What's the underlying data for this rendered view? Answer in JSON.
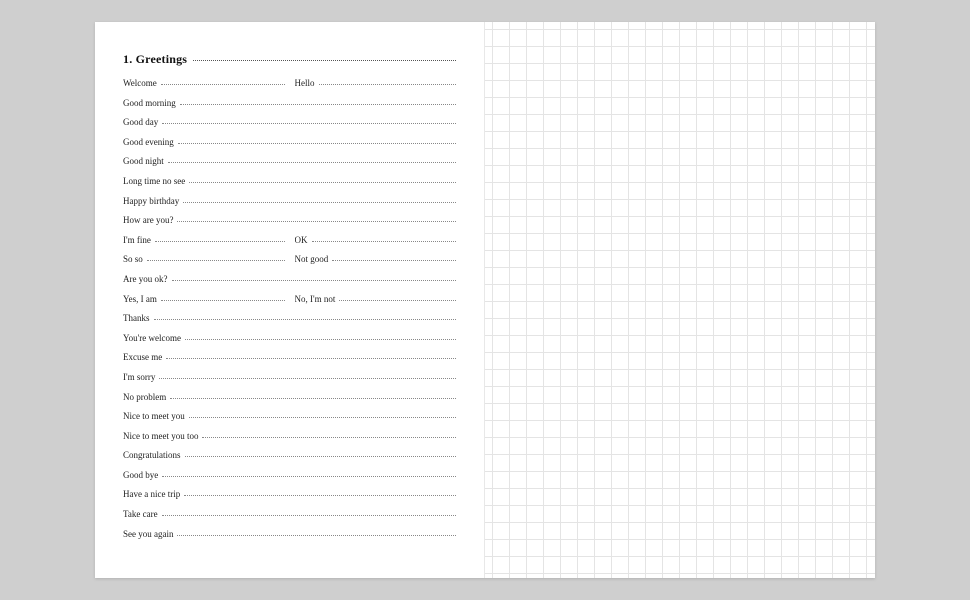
{
  "section": {
    "number": "1.",
    "title": "Greetings"
  },
  "rows": [
    {
      "cells": [
        {
          "label": "Welcome"
        },
        {
          "label": "Hello"
        }
      ]
    },
    {
      "cells": [
        {
          "label": "Good morning"
        }
      ]
    },
    {
      "cells": [
        {
          "label": "Good day"
        }
      ]
    },
    {
      "cells": [
        {
          "label": "Good evening"
        }
      ]
    },
    {
      "cells": [
        {
          "label": "Good night"
        }
      ]
    },
    {
      "cells": [
        {
          "label": "Long time no see"
        }
      ]
    },
    {
      "cells": [
        {
          "label": "Happy birthday"
        }
      ]
    },
    {
      "cells": [
        {
          "label": "How are you?"
        }
      ]
    },
    {
      "cells": [
        {
          "label": "I'm fine"
        },
        {
          "label": "OK"
        }
      ]
    },
    {
      "cells": [
        {
          "label": "So so"
        },
        {
          "label": "Not good"
        }
      ]
    },
    {
      "cells": [
        {
          "label": "Are you ok?"
        }
      ]
    },
    {
      "cells": [
        {
          "label": "Yes, I am"
        },
        {
          "label": "No, I'm not"
        }
      ]
    },
    {
      "cells": [
        {
          "label": "Thanks"
        }
      ]
    },
    {
      "cells": [
        {
          "label": "You're welcome"
        }
      ]
    },
    {
      "cells": [
        {
          "label": "Excuse me"
        }
      ]
    },
    {
      "cells": [
        {
          "label": "I'm sorry"
        }
      ]
    },
    {
      "cells": [
        {
          "label": "No problem"
        }
      ]
    },
    {
      "cells": [
        {
          "label": "Nice to meet you"
        }
      ]
    },
    {
      "cells": [
        {
          "label": "Nice to meet you too"
        }
      ]
    },
    {
      "cells": [
        {
          "label": "Congratulations"
        }
      ]
    },
    {
      "cells": [
        {
          "label": "Good bye"
        }
      ]
    },
    {
      "cells": [
        {
          "label": "Have a nice trip"
        }
      ]
    },
    {
      "cells": [
        {
          "label": "Take care"
        }
      ]
    },
    {
      "cells": [
        {
          "label": "See you again"
        }
      ]
    }
  ]
}
